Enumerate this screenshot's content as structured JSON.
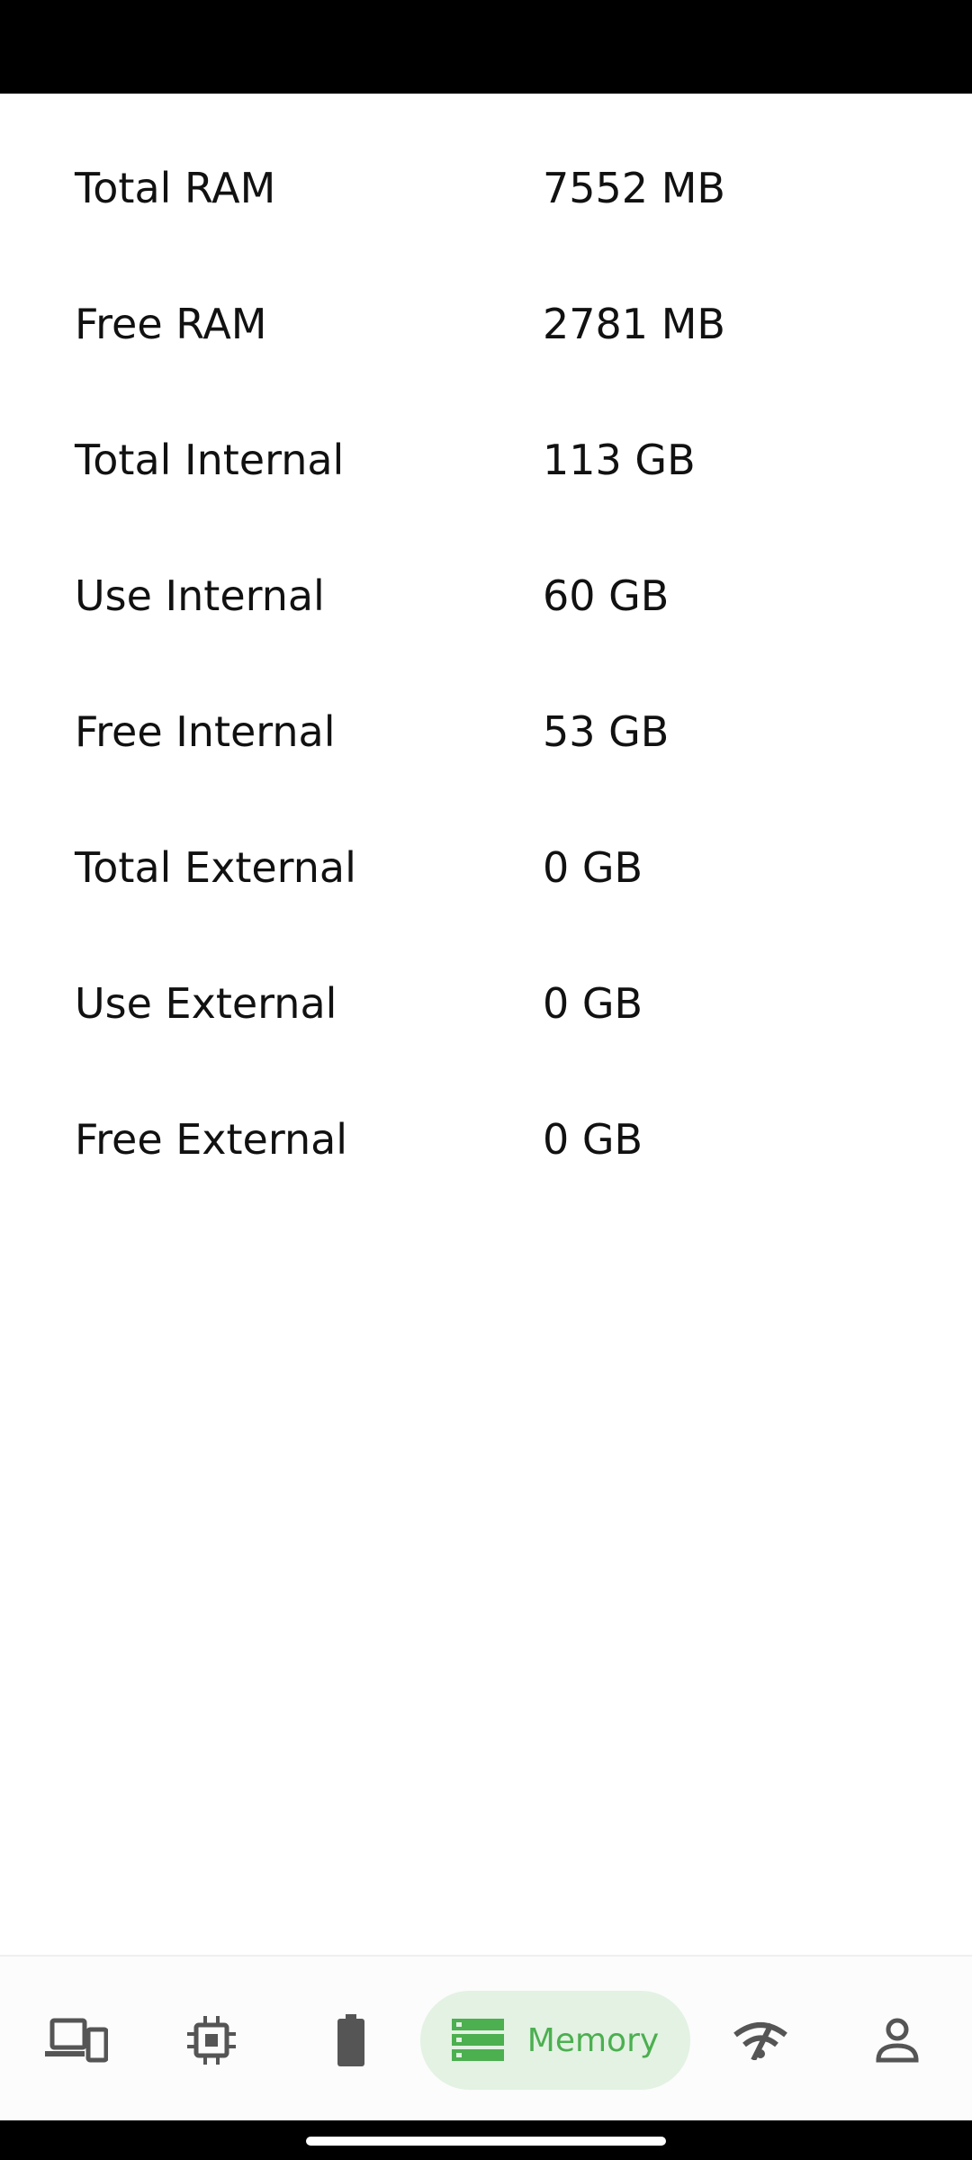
{
  "memory_rows": [
    {
      "label": "Total RAM",
      "value": "7552 MB"
    },
    {
      "label": "Free RAM",
      "value": "2781 MB"
    },
    {
      "label": "Total Internal",
      "value": "113 GB"
    },
    {
      "label": "Use Internal",
      "value": "60 GB"
    },
    {
      "label": "Free Internal",
      "value": "53 GB"
    },
    {
      "label": "Total External",
      "value": "0 GB"
    },
    {
      "label": "Use External",
      "value": "0 GB"
    },
    {
      "label": "Free External",
      "value": "0 GB"
    }
  ],
  "bottom_nav": {
    "items": [
      {
        "icon": "devices-icon"
      },
      {
        "icon": "cpu-icon"
      },
      {
        "icon": "battery-icon"
      },
      {
        "icon": "memory-icon",
        "label": "Memory",
        "active": true
      },
      {
        "icon": "network-icon"
      },
      {
        "icon": "person-icon"
      }
    ],
    "active_color": "#4caf50",
    "active_bg": "#e3f2e3",
    "icon_color": "#555555"
  }
}
